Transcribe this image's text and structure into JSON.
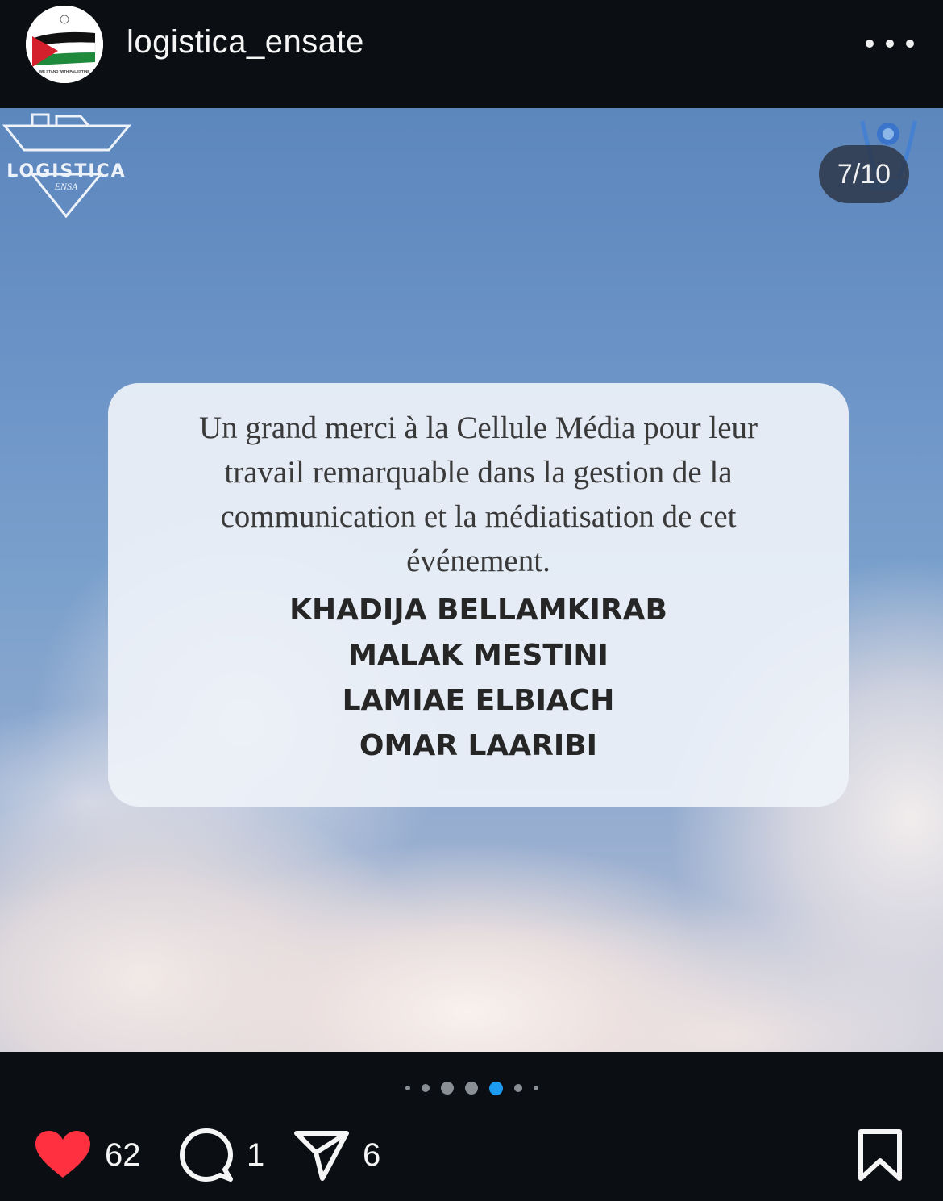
{
  "header": {
    "username": "logistica_ensate",
    "avatar_banner_text": "WE STAND WITH PALESTINE"
  },
  "post": {
    "logo_text": "LOGISTICA",
    "counter": "7/10",
    "message": "Un grand merci à la Cellule Média pour leur travail remarquable dans la gestion de la communication et la médiatisation de cet événement.",
    "names": [
      "KHADIJA BELLAMKIRAB",
      "MALAK MESTINI",
      "LAMIAE ELBIACH",
      "OMAR LAARIBI"
    ]
  },
  "carousel": {
    "total_dots_visible": 7,
    "active_index": 4
  },
  "actions": {
    "likes": "62",
    "comments": "1",
    "shares": "6",
    "like_icon": "heart-filled-icon",
    "comment_icon": "comment-bubble-icon",
    "share_icon": "paper-plane-icon",
    "save_icon": "bookmark-icon",
    "like_color": "#ff3040",
    "active_dot_color": "#1d9bf0"
  }
}
